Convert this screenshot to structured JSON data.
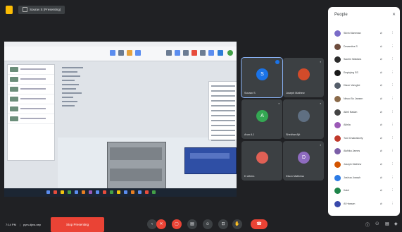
{
  "header": {
    "presenter_title": "Sourav S (Presenting)"
  },
  "main_tiles": [
    {
      "initial": "S",
      "name": "Sourav S",
      "color": "#1a73e8",
      "active": true
    },
    {
      "initial": "",
      "name": "Joseph Mathew",
      "color": "#d24b2a",
      "active": false
    },
    {
      "initial": "A",
      "name": "Arun A J",
      "color": "#34a853",
      "active": false
    },
    {
      "initial": "",
      "name": "Shekhar Ajit",
      "color": "#5f6f82",
      "active": false
    },
    {
      "initial": "",
      "name": "D others",
      "color": "#e06055",
      "active": false
    },
    {
      "initial": "D",
      "name": "Dison Mathews",
      "color": "#8e6bbf",
      "active": false
    }
  ],
  "people_panel": {
    "title": "People",
    "participants": [
      {
        "name": "Silvin Mamman",
        "color": "#7a6cc8"
      },
      {
        "name": "Devamitra S",
        "color": "#6d4c3d"
      },
      {
        "name": "Sachin Waktara",
        "color": "#2b2b2b"
      },
      {
        "name": "Emptyleg SS",
        "color": "#1a1a1a"
      },
      {
        "name": "Dison Varughe",
        "color": "#555e6a"
      },
      {
        "name": "Ninoo Bo Jansen",
        "color": "#8a6a4a"
      },
      {
        "name": "Akhil Nadan",
        "color": "#444444"
      },
      {
        "name": "Akhila",
        "color": "#9b59b6"
      },
      {
        "name": "Tuni Chakraborty",
        "color": "#c0392b"
      },
      {
        "name": "Aishika James",
        "color": "#7b5ea7"
      },
      {
        "name": "Joseph Mathew",
        "color": "#d35400"
      },
      {
        "name": "Joshua Joseph",
        "color": "#2c7be5"
      },
      {
        "name": "Kalel",
        "color": "#1e8449"
      },
      {
        "name": "Al Hassan",
        "color": "#3949ab"
      }
    ]
  },
  "bottom": {
    "time": "7:14 PM",
    "meeting_code": "pym-djnw-nep",
    "stop_presenting": "Stop Presenting",
    "controls": [
      {
        "name": "arrow-icon",
        "glyph": "‹",
        "red": false
      },
      {
        "name": "mic-off-icon",
        "glyph": "✕",
        "red": true
      },
      {
        "name": "camera-off-icon",
        "glyph": "▢",
        "red": true
      },
      {
        "name": "captions-icon",
        "glyph": "▤",
        "red": false
      },
      {
        "name": "emoji-icon",
        "glyph": "☺",
        "red": false
      },
      {
        "name": "present-icon",
        "glyph": "⊡",
        "red": false
      },
      {
        "name": "hand-icon",
        "glyph": "✋",
        "red": false
      },
      {
        "name": "more-icon",
        "glyph": "⋮",
        "red": false
      }
    ],
    "end_call_glyph": "☎"
  }
}
